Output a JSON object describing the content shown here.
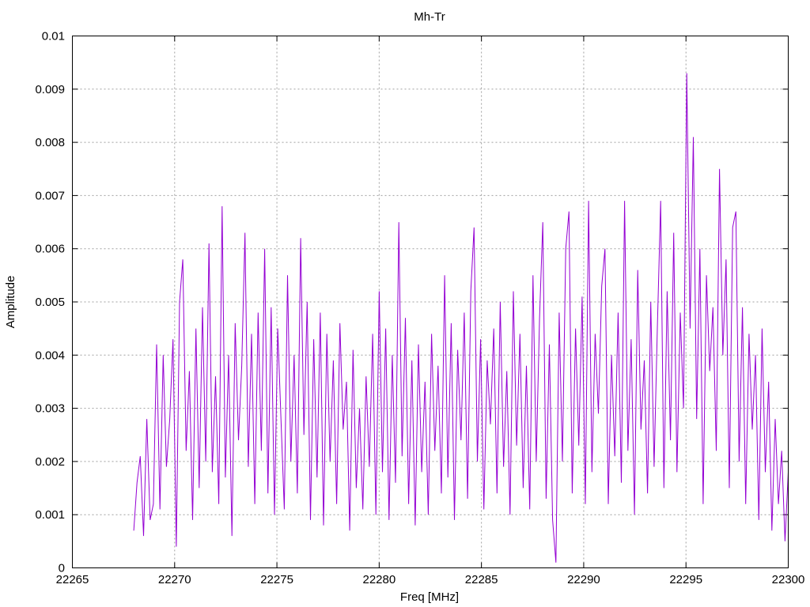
{
  "chart_data": {
    "type": "line",
    "title": "Mh-Tr",
    "xlabel": "Freq [MHz]",
    "ylabel": "Amplitude",
    "xlim": [
      22265,
      22300
    ],
    "ylim": [
      0,
      0.01
    ],
    "x_ticks": [
      "22265",
      "22270",
      "22275",
      "22280",
      "22285",
      "22290",
      "22295",
      "22300"
    ],
    "y_ticks": [
      "0",
      "0.001",
      "0.002",
      "0.003",
      "0.004",
      "0.005",
      "0.006",
      "0.007",
      "0.008",
      "0.009",
      "0.01"
    ],
    "grid": true,
    "legend": "none",
    "series": [
      {
        "name": "Mh-Tr",
        "color": "#9400d3",
        "x_start": 22268,
        "x_step": 0.16,
        "values_e4": [
          7,
          16,
          21,
          6,
          28,
          9,
          12,
          42,
          11,
          40,
          19,
          28,
          43,
          4,
          50,
          58,
          22,
          37,
          9,
          45,
          15,
          49,
          20,
          61,
          18,
          36,
          12,
          68,
          17,
          40,
          6,
          46,
          24,
          38,
          63,
          19,
          44,
          12,
          48,
          22,
          60,
          14,
          49,
          10,
          45,
          28,
          11,
          55,
          20,
          40,
          14,
          62,
          25,
          50,
          9,
          43,
          17,
          48,
          8,
          44,
          20,
          39,
          12,
          46,
          26,
          35,
          7,
          41,
          15,
          30,
          11,
          36,
          19,
          44,
          10,
          52,
          18,
          45,
          9,
          40,
          16,
          65,
          21,
          47,
          12,
          39,
          8,
          42,
          18,
          35,
          10,
          44,
          22,
          38,
          14,
          55,
          17,
          46,
          9,
          41,
          24,
          48,
          13,
          52,
          64,
          20,
          43,
          11,
          39,
          27,
          45,
          14,
          50,
          19,
          37,
          10,
          52,
          23,
          44,
          15,
          38,
          11,
          55,
          20,
          47,
          65,
          13,
          42,
          9,
          1,
          48,
          20,
          60,
          67,
          14,
          45,
          23,
          51,
          12,
          69,
          18,
          44,
          29,
          53,
          60,
          12,
          40,
          21,
          48,
          16,
          69,
          22,
          43,
          10,
          56,
          26,
          39,
          14,
          50,
          19,
          45,
          69,
          15,
          52,
          24,
          63,
          18,
          48,
          30,
          93,
          45,
          81,
          28,
          60,
          12,
          55,
          37,
          49,
          22,
          75,
          40,
          58,
          15,
          64,
          67,
          20,
          49,
          12,
          44,
          26,
          40,
          9,
          45,
          18,
          35,
          7,
          28,
          12,
          22,
          5,
          18
        ]
      }
    ]
  }
}
